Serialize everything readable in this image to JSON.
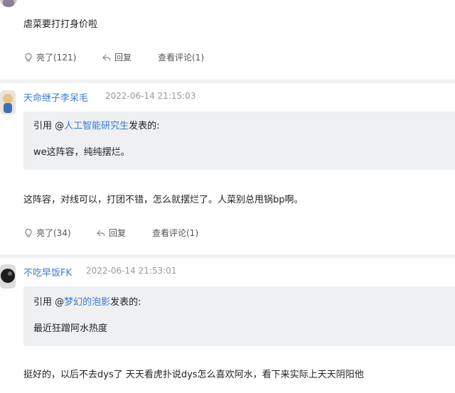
{
  "posts": [
    {
      "content": "虐菜要打打身价啦",
      "like_label": "亮了(121)",
      "reply_label": "回复",
      "view_label": "查看评论(1)"
    },
    {
      "username": "天命继子李呆毛",
      "date": "2022-06-14 21:15:03",
      "quote_prefix": "引用 @",
      "quote_user": "人工智能研究生",
      "quote_suffix": "发表的:",
      "quote_text": "we这阵容，纯纯摆烂。",
      "content": "这阵容，对线可以，打团不错，怎么就摆烂了。人菜别总甩锅bp啊。",
      "like_label": "亮了(34)",
      "reply_label": "回复",
      "view_label": "查看评论(1)"
    },
    {
      "username": "不吃早饭FK",
      "date": "2022-06-14 21:53:01",
      "quote_prefix": "引用 @",
      "quote_user": "梦幻的泡影",
      "quote_suffix": "发表的:",
      "quote_text": "最近狂蹭阿水热度",
      "content": "挺好的，以后不去dys了 天天看虎扑说dys怎么喜欢阿水，看下来实际上天天阴阳他"
    }
  ],
  "colors": {
    "link": "#3a7bd5",
    "quote_bg": "#eef0f2",
    "separator": "#f0f1f3"
  }
}
